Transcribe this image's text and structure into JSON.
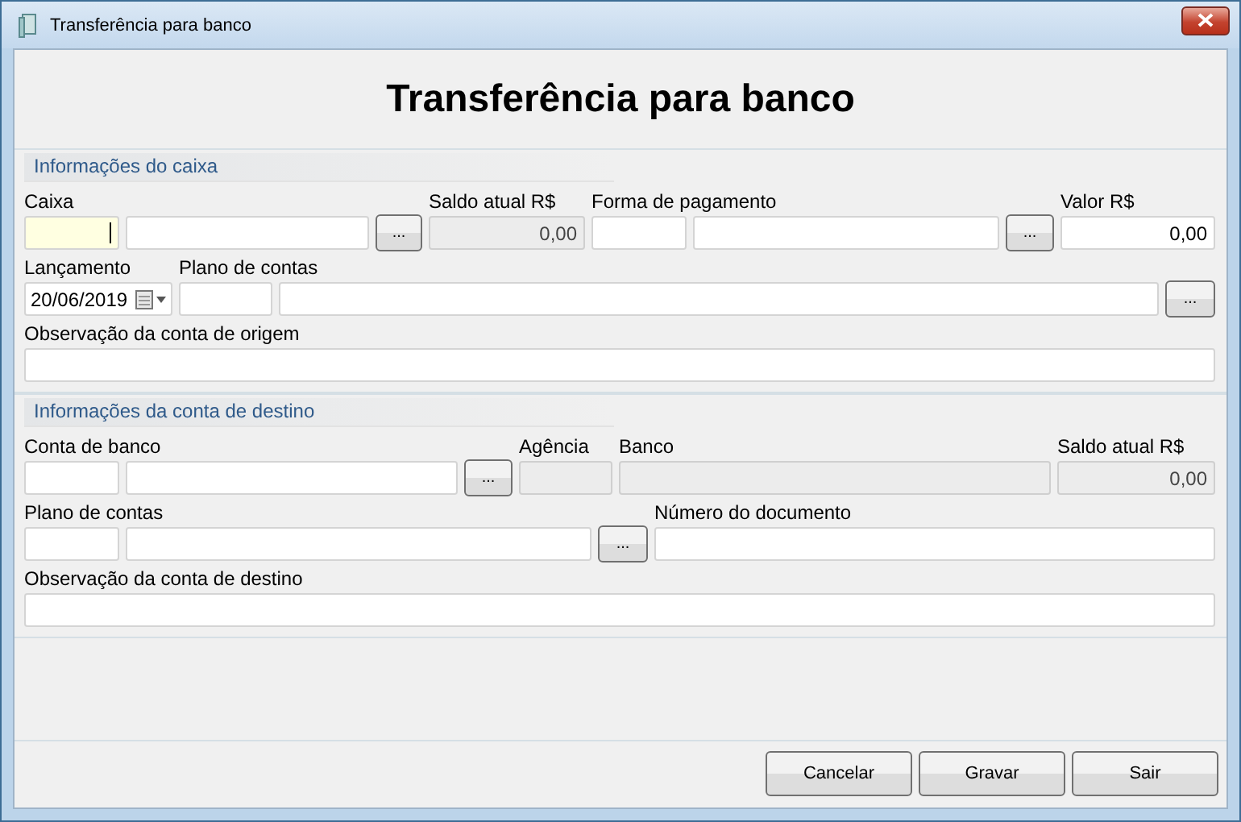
{
  "window": {
    "title": "Transferência para banco"
  },
  "heading": "Transferência para banco",
  "sections": [
    {
      "title": "Informações do caixa",
      "rows": [
        {
          "items": [
            {
              "kind": "field",
              "label": "Caixa",
              "value": "",
              "focused": true,
              "disabled": false
            },
            {
              "kind": "field",
              "value": "",
              "focused": false,
              "disabled": false
            },
            {
              "kind": "button",
              "text": "..."
            },
            {
              "kind": "amount",
              "label": "Saldo atual R$",
              "value": "0,00",
              "focused": false,
              "disabled": true
            },
            {
              "kind": "field",
              "label": "Forma de pagamento",
              "value": "",
              "focused": false,
              "disabled": false
            },
            {
              "kind": "field",
              "value": "",
              "focused": false,
              "disabled": false
            },
            {
              "kind": "button",
              "text": "..."
            },
            {
              "kind": "amount",
              "label": "Valor R$",
              "value": "0,00",
              "focused": false,
              "disabled": false
            }
          ]
        },
        {
          "items": [
            {
              "kind": "date",
              "label": "Lançamento",
              "value": "20/06/2019"
            },
            {
              "kind": "field",
              "label": "Plano de contas",
              "value": "",
              "focused": false,
              "disabled": false
            },
            {
              "kind": "field",
              "value": "",
              "focused": false,
              "disabled": false
            },
            {
              "kind": "button",
              "text": "..."
            }
          ]
        },
        {
          "items": [
            {
              "kind": "field",
              "label": "Observação da conta de origem",
              "value": "",
              "focused": false,
              "disabled": false
            }
          ]
        }
      ]
    },
    {
      "title": "Informações da conta de destino",
      "rows": [
        {
          "items": [
            {
              "kind": "field",
              "label": "Conta de banco",
              "value": "",
              "focused": false,
              "disabled": false
            },
            {
              "kind": "field",
              "value": "",
              "focused": false,
              "disabled": false
            },
            {
              "kind": "button",
              "text": "..."
            },
            {
              "kind": "field",
              "label": "Agência",
              "value": "",
              "focused": false,
              "disabled": true
            },
            {
              "kind": "field",
              "label": "Banco",
              "value": "",
              "focused": false,
              "disabled": true
            },
            {
              "kind": "amount",
              "label": "Saldo atual R$",
              "value": "0,00",
              "focused": false,
              "disabled": true
            }
          ]
        },
        {
          "items": [
            {
              "kind": "field",
              "label": "Plano de contas",
              "value": "",
              "focused": false,
              "disabled": false
            },
            {
              "kind": "field",
              "value": "",
              "focused": false,
              "disabled": false
            },
            {
              "kind": "button",
              "text": "..."
            },
            {
              "kind": "field",
              "label": "Número do documento",
              "value": "",
              "focused": false,
              "disabled": false
            }
          ]
        },
        {
          "items": [
            {
              "kind": "field",
              "label": "Observação da conta de destino",
              "value": "",
              "focused": false,
              "disabled": false
            }
          ]
        }
      ]
    }
  ],
  "buttons": [
    "Cancelar",
    "Gravar",
    "Sair"
  ]
}
